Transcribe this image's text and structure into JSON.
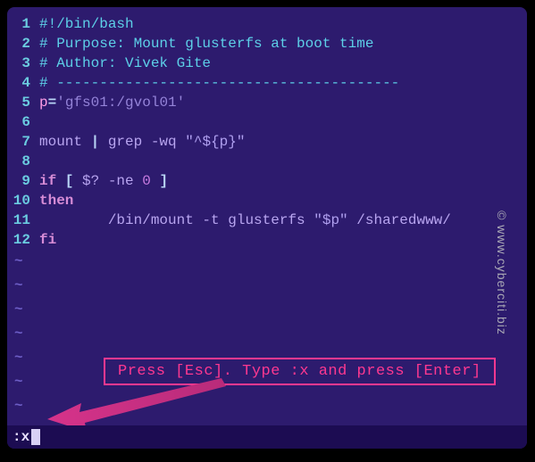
{
  "lines": [
    {
      "n": "1",
      "tokens": [
        {
          "c": "comment",
          "t": "#!/bin/bash"
        }
      ]
    },
    {
      "n": "2",
      "tokens": [
        {
          "c": "comment",
          "t": "# Purpose: Mount glusterfs at boot time"
        }
      ]
    },
    {
      "n": "3",
      "tokens": [
        {
          "c": "comment",
          "t": "# Author: Vivek Gite"
        }
      ]
    },
    {
      "n": "4",
      "tokens": [
        {
          "c": "comment",
          "t": "# ----------------------------------------"
        }
      ]
    },
    {
      "n": "5",
      "tokens": [
        {
          "c": "var-assign",
          "t": "p"
        },
        {
          "c": "op",
          "t": "="
        },
        {
          "c": "string-sq",
          "t": "'gfs01:/gvol01'"
        }
      ]
    },
    {
      "n": "6",
      "tokens": [
        {
          "c": "code",
          "t": " "
        }
      ]
    },
    {
      "n": "7",
      "tokens": [
        {
          "c": "pvar",
          "t": "mount "
        },
        {
          "c": "op",
          "t": "|"
        },
        {
          "c": "pvar",
          "t": " grep -wq "
        },
        {
          "c": "string",
          "t": "\"^${p}\""
        }
      ]
    },
    {
      "n": "8",
      "tokens": [
        {
          "c": "code",
          "t": " "
        }
      ]
    },
    {
      "n": "9",
      "tokens": [
        {
          "c": "keyword",
          "t": "if"
        },
        {
          "c": "op",
          "t": " [ "
        },
        {
          "c": "pvar",
          "t": "$?"
        },
        {
          "c": "op",
          "t": " "
        },
        {
          "c": "pvar",
          "t": "-ne"
        },
        {
          "c": "op",
          "t": " "
        },
        {
          "c": "number",
          "t": "0"
        },
        {
          "c": "op",
          "t": " ]"
        }
      ]
    },
    {
      "n": "10",
      "tokens": [
        {
          "c": "keyword",
          "t": "then"
        }
      ]
    },
    {
      "n": "11",
      "tokens": [
        {
          "c": "pvar",
          "t": "        /bin/mount -t glusterfs "
        },
        {
          "c": "string",
          "t": "\"$p\""
        },
        {
          "c": "pvar",
          "t": " /sharedwww/"
        }
      ]
    },
    {
      "n": "12",
      "tokens": [
        {
          "c": "keyword",
          "t": "fi"
        }
      ]
    }
  ],
  "tildes": [
    "~",
    "~",
    "~",
    "~",
    "~",
    "~",
    "~",
    "~"
  ],
  "hint": "Press [Esc]. Type :x  and press [Enter]",
  "status": ":x",
  "watermark": "© www.cyberciti.biz"
}
